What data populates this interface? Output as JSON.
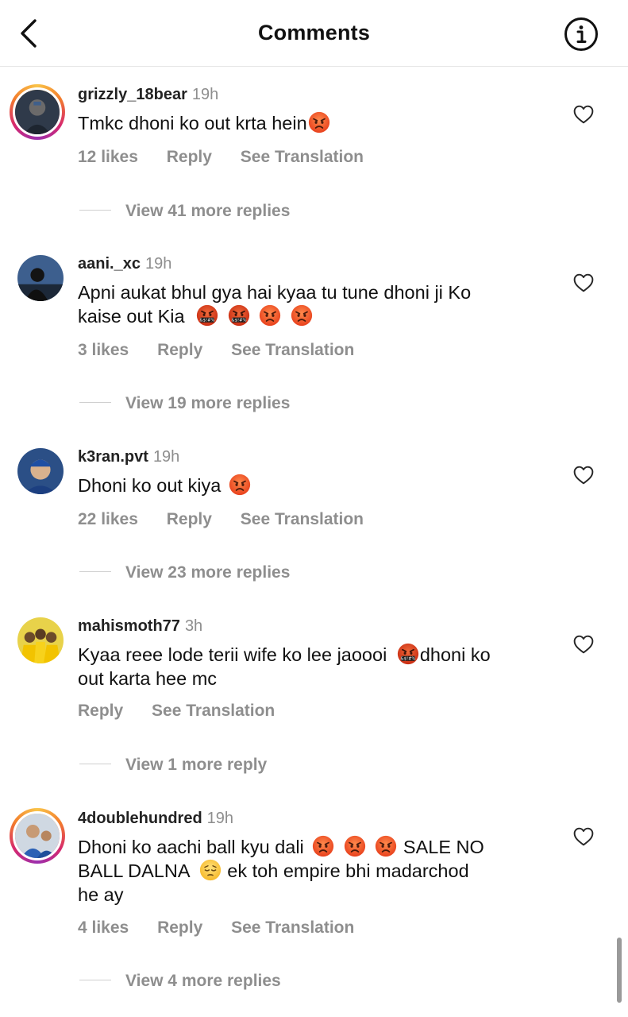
{
  "header": {
    "title": "Comments"
  },
  "comments": [
    {
      "username": "grizzly_18bear",
      "time": "19h",
      "text": "Tmkc dhoni ko out krta hein",
      "emojis": [
        "angry"
      ],
      "likes": "12 likes",
      "reply": "Reply",
      "translate": "See Translation",
      "view_more": "View 41 more replies"
    },
    {
      "username": "aani._xc",
      "time": "19h",
      "text_line1": "Apni aukat bhul gya hai kyaa tu tune dhoni ji Ko",
      "text_line2": "kaise out Kia",
      "emojis": [
        "cursing",
        "cursing",
        "angry",
        "angry"
      ],
      "likes": "3 likes",
      "reply": "Reply",
      "translate": "See Translation",
      "view_more": "View 19 more replies"
    },
    {
      "username": "k3ran.pvt",
      "time": "19h",
      "text": "Dhoni ko out kiya",
      "emojis": [
        "angry"
      ],
      "likes": "22 likes",
      "reply": "Reply",
      "translate": "See Translation",
      "view_more": "View 23 more replies"
    },
    {
      "username": "mahismoth77",
      "time": "3h",
      "text_part1": "Kyaa reee lode terii wife ko lee jaoooi",
      "text_part2": "dhoni ko",
      "text_line2": "out karta hee mc",
      "emojis": [
        "cursing"
      ],
      "reply": "Reply",
      "translate": "See Translation",
      "view_more": "View 1 more reply"
    },
    {
      "username": "4doublehundred",
      "time": "19h",
      "text_part1": "Dhoni ko aachi ball kyu dali",
      "text_part2": "SALE NO",
      "text_part3": "BALL DALNA",
      "text_part4": "ek toh empire bhi madarchod",
      "text_line3": "he ay",
      "emojis": [
        "angry",
        "angry",
        "angry",
        "pensive"
      ],
      "likes": "4 likes",
      "reply": "Reply",
      "translate": "See Translation",
      "view_more": "View 4 more replies"
    }
  ],
  "colors": {
    "text": "#111111",
    "muted": "#8e8e8e",
    "angry": "#f4511e",
    "ring": "#d6286e"
  },
  "icons": [
    "chevron-left-icon",
    "info-icon",
    "heart-outline-icon",
    "angry-face-emoji",
    "cursing-face-emoji",
    "pensive-face-emoji"
  ]
}
